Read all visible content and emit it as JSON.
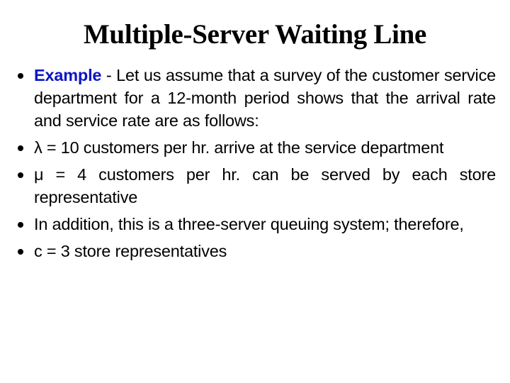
{
  "slide": {
    "title": "Multiple-Server Waiting Line",
    "accent_color": "#0a14c8",
    "bullets": [
      {
        "lead": "Example",
        "text": " - Let us assume that a survey of the customer service department for a 12-month period shows that the arrival rate and service rate are as follows:"
      },
      {
        "lead": "",
        "text": "λ = 10 customers per hr. arrive at the service department"
      },
      {
        "lead": "",
        "text": "μ = 4 customers per hr. can be served by each store representative"
      },
      {
        "lead": "",
        "text": "In addition, this is a three-server queuing system; therefore,"
      },
      {
        "lead": "",
        "text": "c = 3 store representatives"
      }
    ]
  }
}
